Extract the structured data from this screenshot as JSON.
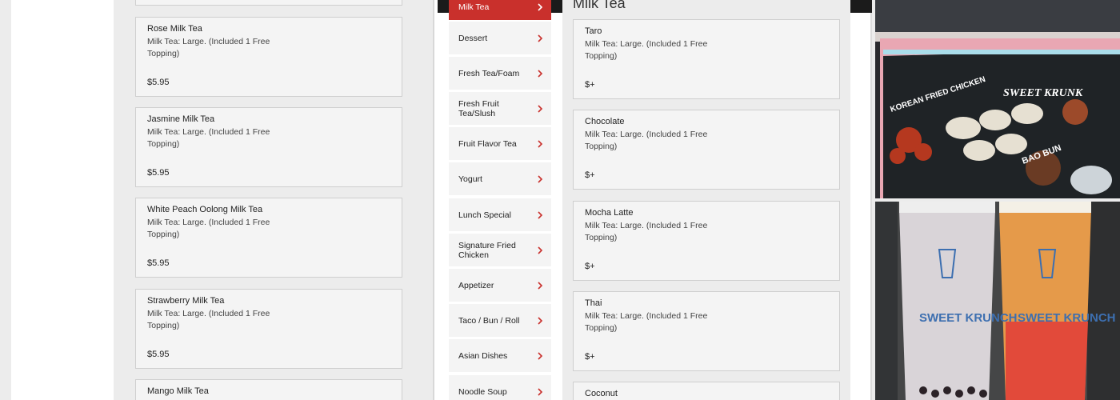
{
  "left_items": [
    {
      "name": "Rose Milk Tea",
      "desc": "Milk Tea: Large. (Included 1 Free Topping)",
      "price": "$5.95"
    },
    {
      "name": "Jasmine Milk Tea",
      "desc": "Milk Tea: Large. (Included 1 Free Topping)",
      "price": "$5.95"
    },
    {
      "name": "White Peach Oolong Milk Tea",
      "desc": "Milk Tea: Large. (Included 1 Free Topping)",
      "price": "$5.95"
    },
    {
      "name": "Strawberry Milk Tea",
      "desc": "Milk Tea: Large. (Included 1 Free Topping)",
      "price": "$5.95"
    },
    {
      "name": "Mango Milk Tea",
      "desc": "",
      "price": ""
    }
  ],
  "categories": [
    {
      "label": "Milk Tea",
      "active": true
    },
    {
      "label": "Dessert"
    },
    {
      "label": "Fresh Tea/Foam"
    },
    {
      "label": "Fresh Fruit Tea/Slush"
    },
    {
      "label": "Fruit Flavor Tea"
    },
    {
      "label": "Yogurt"
    },
    {
      "label": "Lunch Special"
    },
    {
      "label": "Signature Fried Chicken"
    },
    {
      "label": "Appetizer"
    },
    {
      "label": "Taco / Bun / Roll"
    },
    {
      "label": "Asian Dishes"
    },
    {
      "label": "Noodle Soup"
    }
  ],
  "section_title": "Milk Tea",
  "right_items": [
    {
      "name": "Taro",
      "desc": "Milk Tea: Large. (Included 1 Free Topping)",
      "price": "$+"
    },
    {
      "name": "Chocolate",
      "desc": "Milk Tea: Large. (Included 1 Free Topping)",
      "price": "$+"
    },
    {
      "name": "Mocha Latte",
      "desc": "Milk Tea: Large. (Included 1 Free Topping)",
      "price": "$+"
    },
    {
      "name": "Thai",
      "desc": "Milk Tea: Large. (Included 1 Free Topping)",
      "price": "$+"
    },
    {
      "name": "Coconut",
      "desc": "",
      "price": ""
    }
  ],
  "photo1": {
    "sign_text": "KOREAN FRIED CHICKEN",
    "brand": "SWEET KRUNK",
    "sign_text_2": "BAO BUN"
  },
  "photo2": {
    "cup_text": "SWEET KRUNCH"
  },
  "colors": {
    "accent": "#c9302c",
    "card_bg": "#f4f4f4",
    "panel_bg": "#ececec"
  },
  "icons": {
    "category_chevron": "chevron-right-icon"
  }
}
